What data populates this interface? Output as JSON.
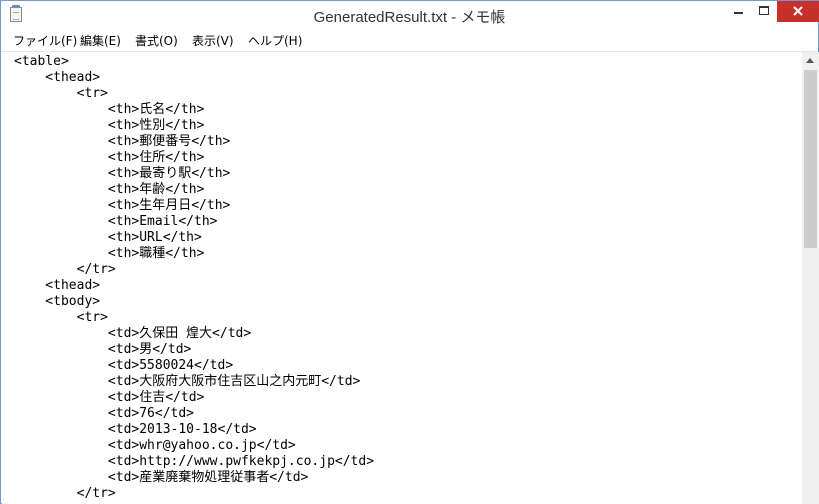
{
  "window": {
    "title": "GeneratedResult.txt - メモ帳",
    "accent_color": "#c7312c"
  },
  "menu": [
    {
      "label": "ファイル(F)"
    },
    {
      "label": "編集(E)"
    },
    {
      "label": "書式(O)"
    },
    {
      "label": "表示(V)"
    },
    {
      "label": "ヘルプ(H)"
    }
  ],
  "editor": {
    "lines": [
      "<table>",
      "    <thead>",
      "        <tr>",
      "            <th>氏名</th>",
      "            <th>性別</th>",
      "            <th>郵便番号</th>",
      "            <th>住所</th>",
      "            <th>最寄り駅</th>",
      "            <th>年齢</th>",
      "            <th>生年月日</th>",
      "            <th>Email</th>",
      "            <th>URL</th>",
      "            <th>職種</th>",
      "        </tr>",
      "    <thead>",
      "    <tbody>",
      "        <tr>",
      "            <td>久保田 煌大</td>",
      "            <td>男</td>",
      "            <td>5580024</td>",
      "            <td>大阪府大阪市住吉区山之内元町</td>",
      "            <td>住吉</td>",
      "            <td>76</td>",
      "            <td>2013-10-18</td>",
      "            <td>whr@yahoo.co.jp</td>",
      "            <td>http://www.pwfkekpj.co.jp</td>",
      "            <td>産業廃棄物処理従事者</td>",
      "        </tr>"
    ]
  },
  "icons": {
    "app": "notepad-icon",
    "minimize": "minimize-icon",
    "maximize": "maximize-icon",
    "close": "close-icon",
    "scroll_up": "scroll-up-arrow-icon"
  }
}
